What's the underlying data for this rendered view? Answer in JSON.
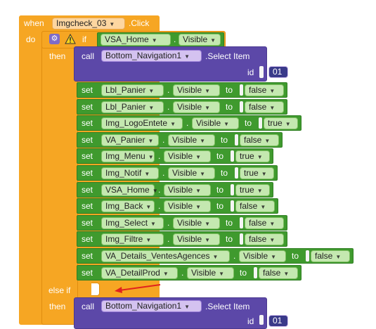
{
  "event": {
    "when_label": "when",
    "component": "Imgcheck_03",
    "event_name": ".Click",
    "do_label": "do"
  },
  "if_block": {
    "if_label": "if",
    "condition_component": "VSA_Home",
    "condition_property": "Visible",
    "then_label": "then",
    "else_if_label": "else if"
  },
  "call_1": {
    "call_label": "call",
    "component": "Bottom_Navigation1",
    "method": ".Select Item",
    "param_label": "id",
    "param_value": "01"
  },
  "set_rows": [
    {
      "set": "set",
      "component": "Lbl_Panier",
      "property": "Visible",
      "to": "to",
      "value": "false"
    },
    {
      "set": "set",
      "component": "Lbl_Panier",
      "property": "Visible",
      "to": "to",
      "value": "false"
    },
    {
      "set": "set",
      "component": "Img_LogoEntete",
      "property": "Visible",
      "to": "to",
      "value": "true"
    },
    {
      "set": "set",
      "component": "VA_Panier",
      "property": "Visible",
      "to": "to",
      "value": "false"
    },
    {
      "set": "set",
      "component": "Img_Menu",
      "property": "Visible",
      "to": "to",
      "value": "true"
    },
    {
      "set": "set",
      "component": "Img_Notif",
      "property": "Visible",
      "to": "to",
      "value": "true"
    },
    {
      "set": "set",
      "component": "VSA_Home",
      "property": "Visible",
      "to": "to",
      "value": "true"
    },
    {
      "set": "set",
      "component": "Img_Back",
      "property": "Visible",
      "to": "to",
      "value": "false"
    },
    {
      "set": "set",
      "component": "Img_Select",
      "property": "Visible",
      "to": "to",
      "value": "false"
    },
    {
      "set": "set",
      "component": "Img_Filtre",
      "property": "Visible",
      "to": "to",
      "value": "false"
    },
    {
      "set": "set",
      "component": "VA_Details_VentesAgences",
      "property": "Visible",
      "to": "to",
      "value": "false"
    },
    {
      "set": "set",
      "component": "VA_DetailProd",
      "property": "Visible",
      "to": "to",
      "value": "false"
    }
  ],
  "call_2": {
    "then_label": "then",
    "call_label": "call",
    "component": "Bottom_Navigation1",
    "method": ".Select Item",
    "param_label": "id",
    "param_value": "01"
  },
  "colors": {
    "event": "#f6a623",
    "control": "#f6a623",
    "component_green": "#3f9a2e",
    "procedure_purple": "#5c48a8",
    "annotation_arrow": "#e0221e"
  }
}
